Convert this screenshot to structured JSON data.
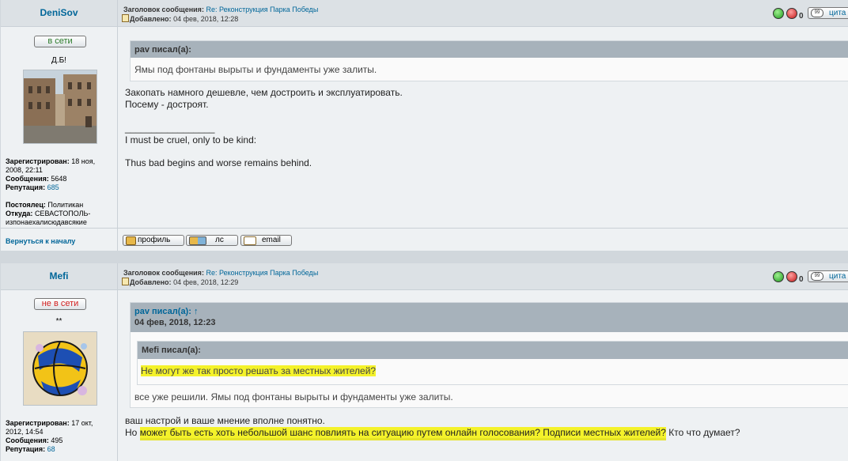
{
  "common": {
    "subject_label": "Заголовок сообщения:",
    "posted_label": "Добавлено:",
    "quote_button": "цита",
    "back_to_top": "Вернуться к началу",
    "buttons": {
      "profile": "профиль",
      "pm": "лс",
      "email": "email"
    },
    "colors": {
      "accent": "#006699",
      "online": "#2a7a2a",
      "offline": "#d21f1f",
      "highlight": "#f4f22a"
    },
    "icons": [
      "post-icon",
      "thumb-up-icon",
      "thumb-down-icon",
      "speech-bubble-icon",
      "profile-icon",
      "pm-icon",
      "email-icon"
    ]
  },
  "posts": [
    {
      "author": "DeniSov",
      "status": "в сети",
      "rank": "Д.Б!",
      "subject": "Re: Реконструкция Парка Победы",
      "date": "04 фев, 2018, 12:28",
      "votes": "0",
      "profile": {
        "registered_label": "Зарегистрирован:",
        "registered": "18 ноя,",
        "registered_2": "2008, 22:11",
        "messages_label": "Сообщения:",
        "messages": "5648",
        "reputation_label": "Репутация:",
        "reputation": "685",
        "resident_label": "Постоялец:",
        "resident": "Политикан",
        "from_label": "Откуда:",
        "from": "СЕВАСТОПОЛЬ-",
        "from_2": "изпонаехалисюдавсякие"
      },
      "quote": {
        "author": "pav писал(а):",
        "text": "Ямы под фонтаны вырыты и фундаменты уже залиты."
      },
      "lines": [
        "Закопать намного дешевле, чем достроить и эксплуатировать.",
        "Посему - достроят.",
        "_________________",
        "I must be cruel, only to be kind:",
        "Thus bad begins and worse remains behind."
      ]
    },
    {
      "author": "Mefi",
      "status": "не в сети",
      "rank": "**",
      "subject": "Re: Реконструкция Парка Победы",
      "date": "04 фев, 2018, 12:29",
      "votes": "0",
      "profile": {
        "registered_label": "Зарегистрирован:",
        "registered": "17 окт,",
        "registered_2": "2012, 14:54",
        "messages_label": "Сообщения:",
        "messages": "495",
        "reputation_label": "Репутация:",
        "reputation": "68"
      },
      "quote": {
        "author": "pav писал(а):",
        "arrow": "↑",
        "date": "04 фев, 2018, 12:23",
        "nested_author": "Mefi писал(а):",
        "nested_text": "Не могут же так просто решать за местных жителей?",
        "text": "все уже решили. Ямы под фонтаны вырыты и фундаменты уже залиты."
      },
      "line1": "ваш настрой и ваше мнение вполне понятно.",
      "line2_a": "Но ",
      "line2_b": "может быть есть хоть небольшой шанс повлиять на ситуацию путем онлайн голосования? Подписи местных жителей?",
      "line2_c": " Кто что думает?"
    }
  ]
}
